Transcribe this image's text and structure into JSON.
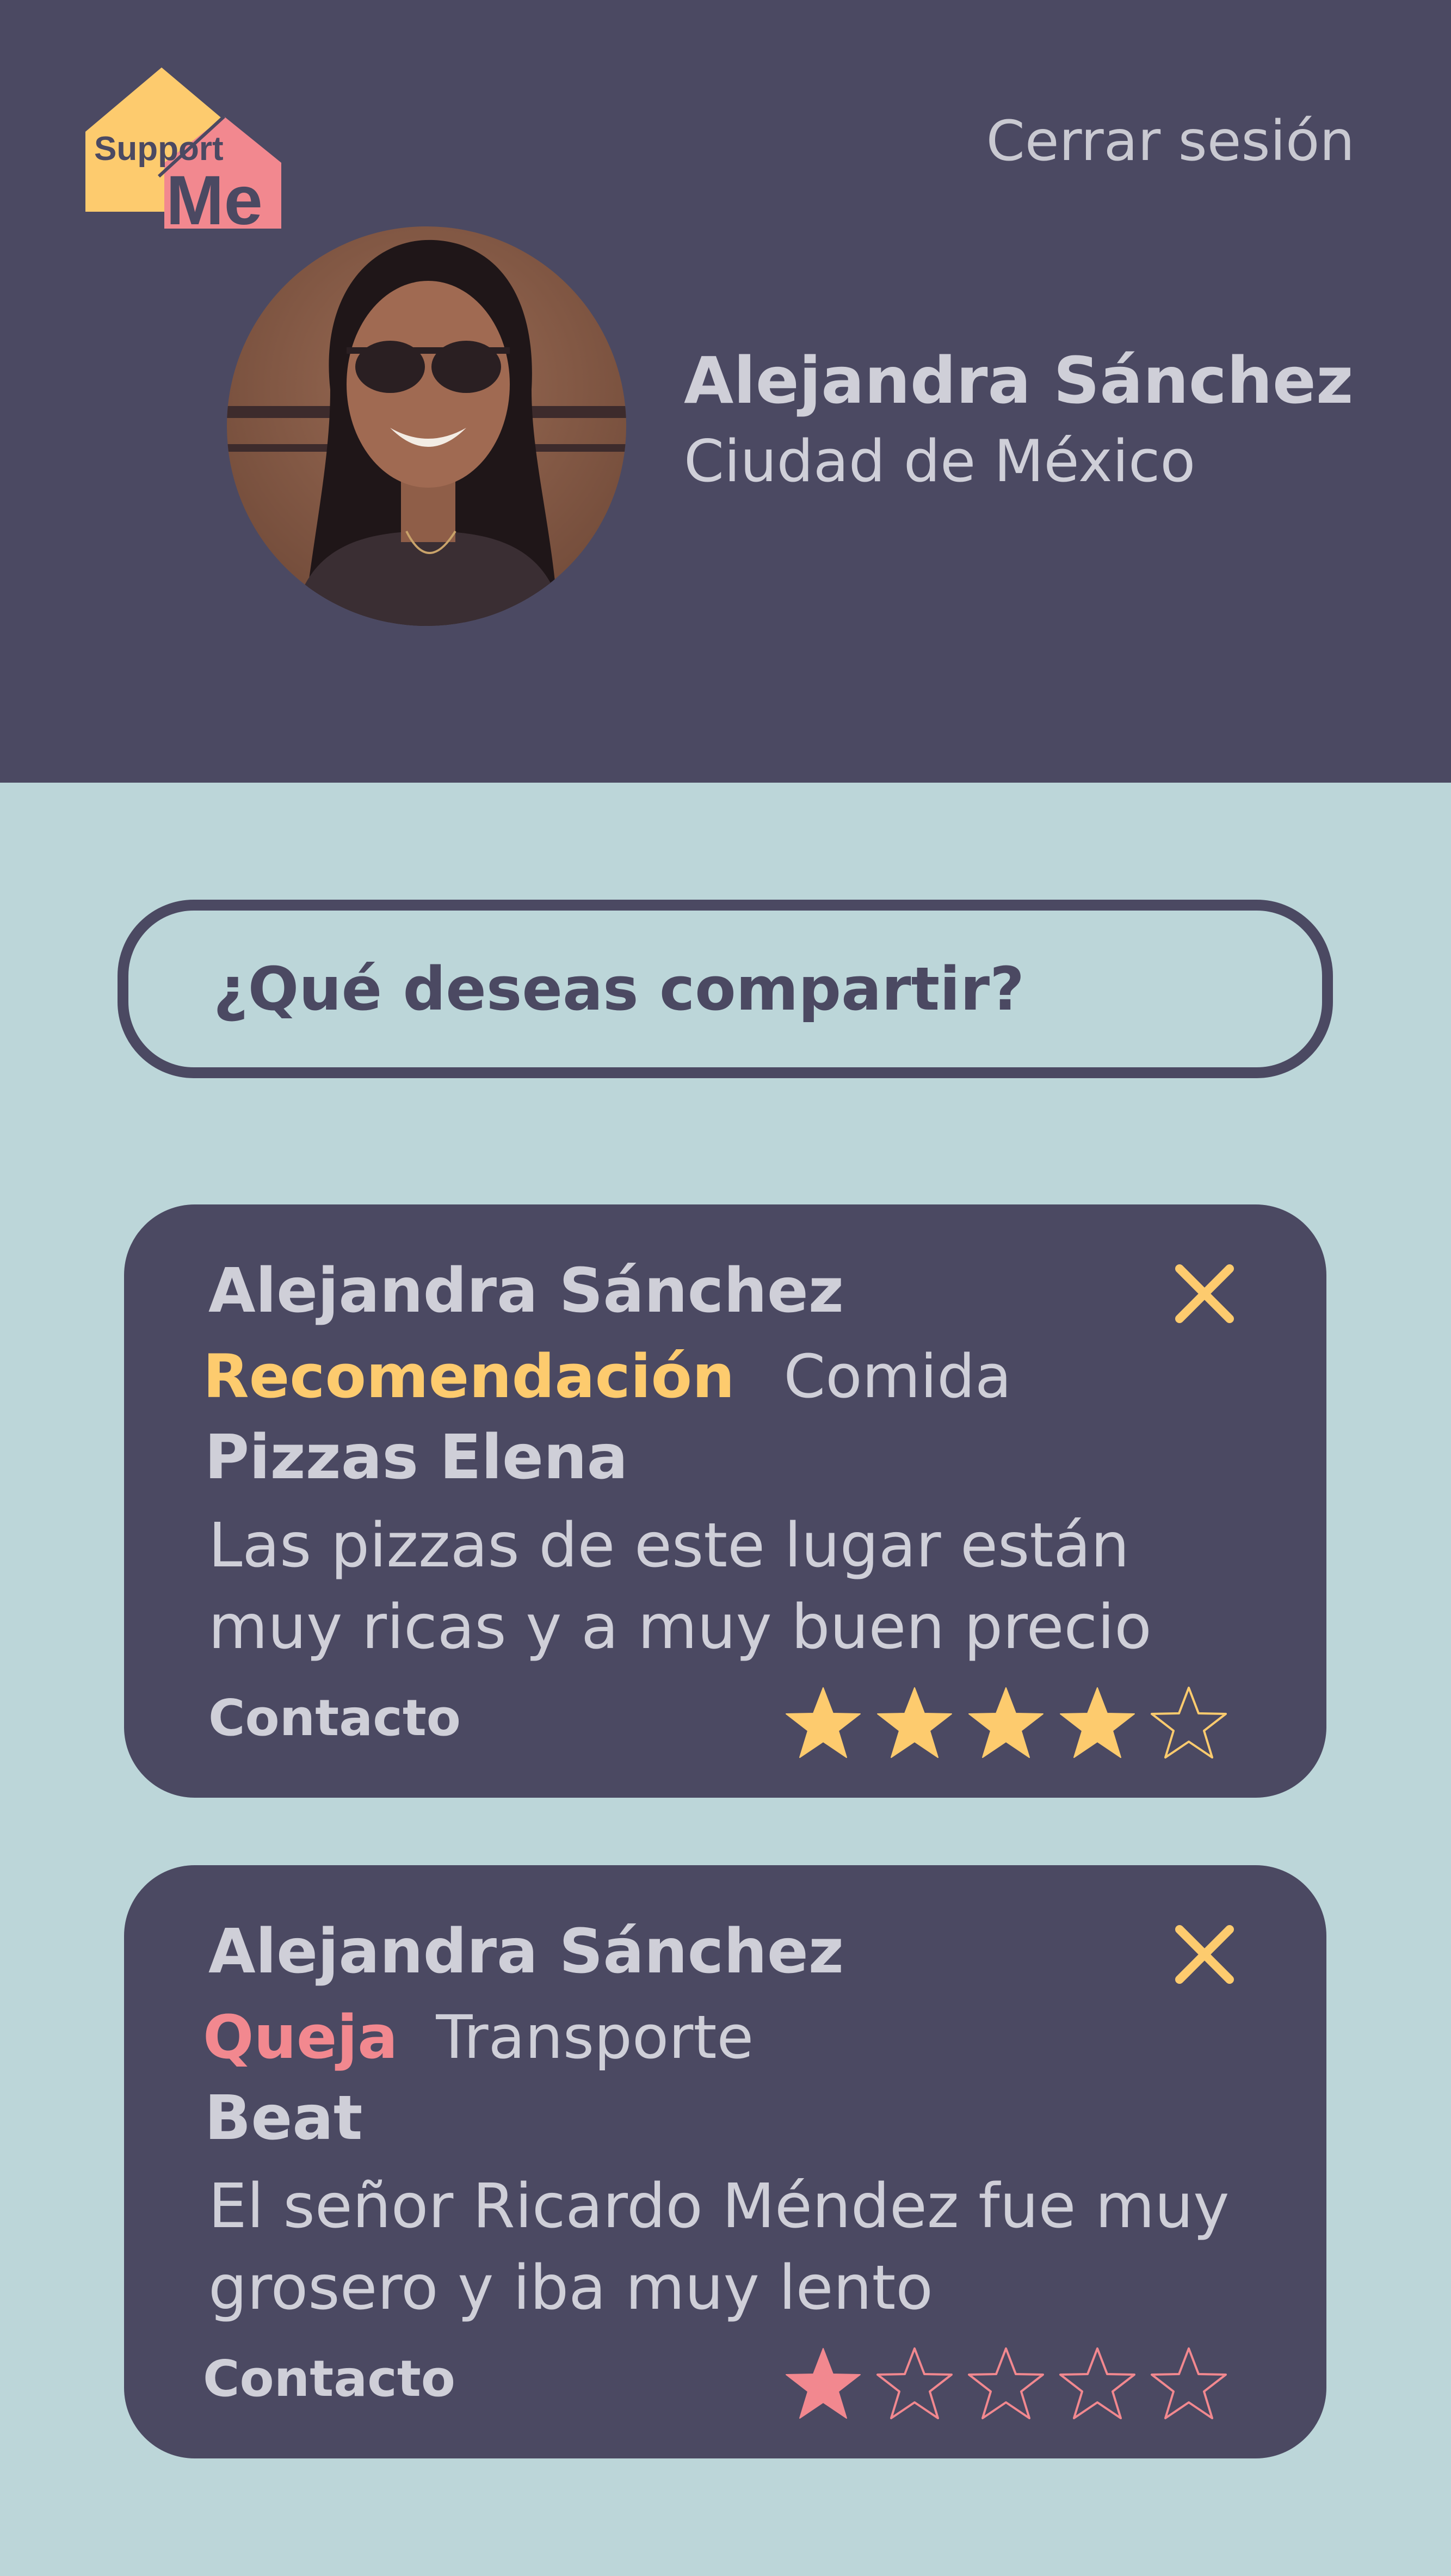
{
  "app": {
    "logo_text_top": "Support",
    "logo_text_bottom": "Me",
    "logout_label": "Cerrar sesión"
  },
  "profile": {
    "name": "Alejandra Sánchez",
    "city": "Ciudad de México"
  },
  "composer": {
    "prompt": "¿Qué deseas compartir?"
  },
  "posts": [
    {
      "author": "Alejandra Sánchez",
      "type": "Recomendación",
      "type_color": "#fdcb6e",
      "category": "Comida",
      "place": "Pizzas Elena",
      "text": "Las pizzas de este lugar están muy ricas y a muy buen precio",
      "contact_label": "Contacto",
      "rating": 4,
      "max_rating": 5,
      "star_color": "#fdcb6e"
    },
    {
      "author": "Alejandra Sánchez",
      "type": "Queja",
      "type_color": "#f2888f",
      "category": "Transporte",
      "place": "Beat",
      "text": "El señor Ricardo Méndez fue muy grosero y iba muy lento",
      "contact_label": "Contacto",
      "rating": 1,
      "max_rating": 5,
      "star_color": "#f2888f"
    }
  ],
  "colors": {
    "header_bg": "#4b4962",
    "page_bg": "#bcd6d9",
    "accent_yellow": "#fdcb6e",
    "accent_pink": "#f2888f",
    "text_light": "#cfcfd8"
  }
}
